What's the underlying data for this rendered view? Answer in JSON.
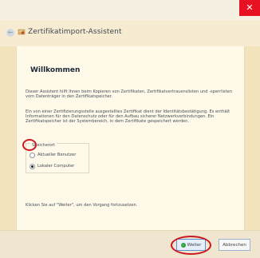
{
  "window": {
    "title": "Zertifikatimport-Assistent",
    "close_icon": "close-icon"
  },
  "wizard": {
    "heading": "Willkommen",
    "intro": "Dieser Assistent hilft Ihnen beim Kopieren von Zertifikaten, Zertifikatvertrauenslisten und -sperrlisten vom Datenträger in den Zertifikatspeicher.",
    "explanation": "Ein von einer Zertifizierungsstelle ausgestelltes Zertifikat dient der Identitätsbestätigung. Es enthält Informationen für den Datenschutz oder für den Aufbau sicherer Netzwerkverbindungen. Ein Zertifikatspeicher ist der Systembereich, in dem Zertifikate gespeichert werden.",
    "storage_location": {
      "label": "Speicherort",
      "options": [
        {
          "label": "Aktueller Benutzer",
          "selected": false
        },
        {
          "label": "Lokaler Computer",
          "selected": true
        }
      ]
    },
    "continue_hint": "Klicken Sie auf \"Weiter\", um den Vorgang fortzusetzen."
  },
  "buttons": {
    "next": "Weiter",
    "cancel": "Abbrechen"
  },
  "colors": {
    "accent_red": "#cc1721",
    "close_red": "#e81123"
  }
}
